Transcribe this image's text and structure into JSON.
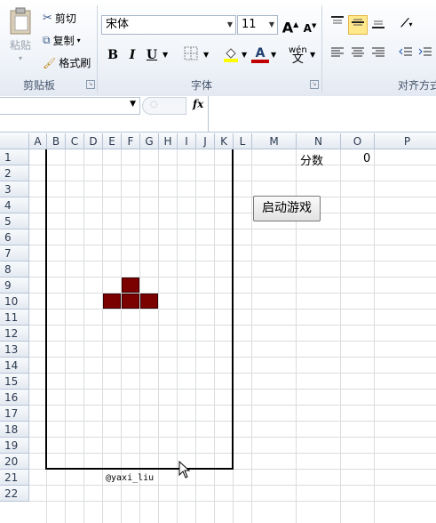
{
  "ribbon": {
    "clipboard": {
      "paste_label": "粘贴",
      "cut_label": "剪切",
      "copy_label": "复制",
      "format_painter_label": "格式刷",
      "group_label": "剪贴板"
    },
    "font": {
      "font_name": "宋体",
      "font_size": "11",
      "group_label": "字体",
      "grow_label": "A",
      "shrink_label": "A",
      "bold_label": "B",
      "italic_label": "I",
      "underline_label": "U",
      "font_color_label": "A",
      "phonetic_label": "wén"
    },
    "alignment": {
      "group_label": "对齐方式"
    }
  },
  "formula_bar": {
    "fx_label": "fx"
  },
  "sheet": {
    "columns": [
      "A",
      "B",
      "C",
      "D",
      "E",
      "F",
      "G",
      "H",
      "I",
      "J",
      "K",
      "L",
      "M",
      "N",
      "O",
      "P"
    ],
    "rows": [
      "1",
      "2",
      "3",
      "4",
      "5",
      "6",
      "7",
      "8",
      "9",
      "10",
      "11",
      "12",
      "13",
      "14",
      "15",
      "16",
      "17",
      "18",
      "19",
      "20",
      "21",
      "22"
    ],
    "score_label": "分数",
    "score_value": "0",
    "start_button": "启动游戏",
    "credit": "@yaxi_liu"
  },
  "colors": {
    "piece": "#7b0000",
    "highlight": "#ffe98a"
  }
}
